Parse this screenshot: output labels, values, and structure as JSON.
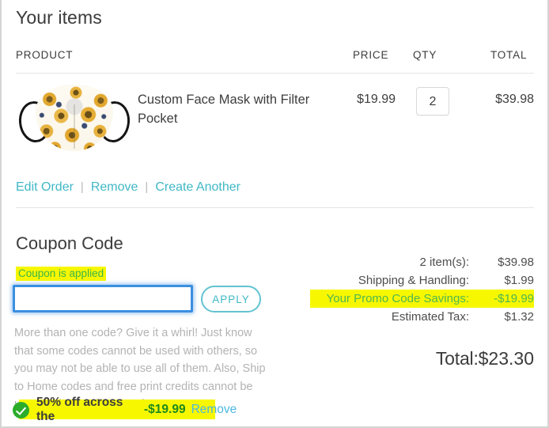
{
  "header": {
    "title": "Your items"
  },
  "table": {
    "columns": {
      "product": "PRODUCT",
      "price": "PRICE",
      "qty": "QTY",
      "total": "TOTAL"
    },
    "rows": [
      {
        "image_alt": "face-mask-sunflower-pattern",
        "name": "Custom Face Mask with Filter Pocket",
        "price": "$19.99",
        "qty": "2",
        "total": "$39.98"
      }
    ]
  },
  "actions": {
    "edit_order": "Edit Order",
    "separator": "|",
    "remove": "Remove",
    "create_another": "Create Another"
  },
  "coupon": {
    "title": "Coupon Code",
    "applied_message": "Coupon is applied",
    "input_value": "",
    "input_placeholder": "",
    "apply_label": "APPLY",
    "note": "More than one code? Give it a whirl! Just know that some codes cannot be used with others, so you may not be able to use all of them. Also, Ship to Home codes and free print credits cannot be used for items picked up in store.",
    "applied": {
      "description": "50% off across the",
      "amount": "-$19.99",
      "remove_label": "Remove"
    }
  },
  "summary": {
    "rows": [
      {
        "label": "2 item(s):",
        "value": "$39.98",
        "highlight": false
      },
      {
        "label": "Shipping & Handling:",
        "value": "$1.99",
        "highlight": false
      },
      {
        "label": "Your Promo Code Savings:",
        "value": "-$19.99",
        "highlight": true
      },
      {
        "label": "Estimated Tax:",
        "value": "$1.32",
        "highlight": false
      }
    ],
    "total_label": "Total:",
    "total_value": "$23.30"
  },
  "colors": {
    "link": "#3fb8c6",
    "highlight": "#f7f700",
    "success_green": "#3cb54a",
    "focus_blue": "#3b8fe0",
    "text": "#3d3d3d"
  }
}
